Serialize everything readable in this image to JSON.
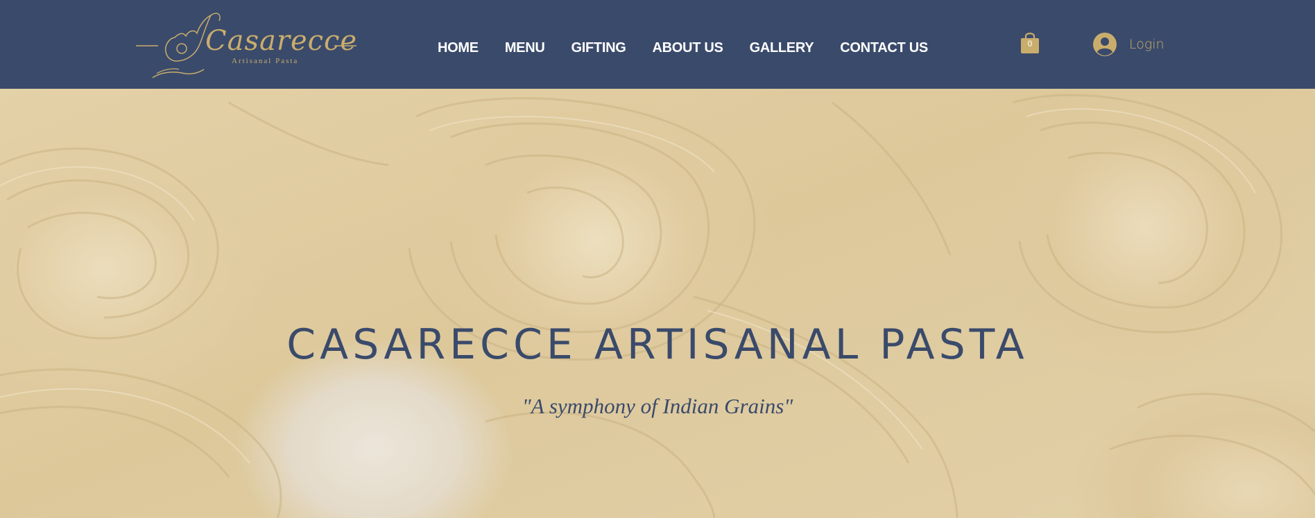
{
  "header": {
    "logo": {
      "name": "Casarecce",
      "subtitle": "Artisanal Pasta"
    },
    "nav": [
      {
        "label": "HOME"
      },
      {
        "label": "MENU"
      },
      {
        "label": "GIFTING"
      },
      {
        "label": "ABOUT US"
      },
      {
        "label": "GALLERY"
      },
      {
        "label": "CONTACT US"
      }
    ],
    "cart": {
      "count": "0",
      "icon": "shopping-bag-icon"
    },
    "login": {
      "label": "Login",
      "icon": "user-avatar-icon"
    }
  },
  "hero": {
    "title": "CASARECCE ARTISANAL PASTA",
    "tagline": "\"A symphony of Indian Grains\""
  },
  "colors": {
    "header_bg": "#3a4a6b",
    "gold": "#c9ad6c",
    "nav_text": "#ffffff",
    "hero_text": "#3a4a6b",
    "pasta": "#d9c08b"
  }
}
